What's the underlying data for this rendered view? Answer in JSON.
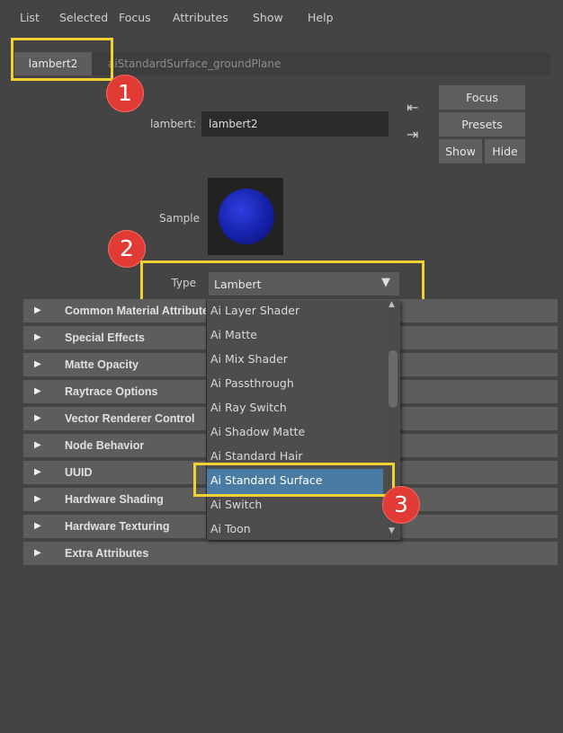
{
  "menu": [
    "List",
    "Selected",
    "Focus",
    "Attributes",
    "Show",
    "Help"
  ],
  "tabs": [
    {
      "label": "lambert2",
      "active": true
    },
    {
      "label": "aiStandardSurface_groundPlane",
      "active": false
    }
  ],
  "node": {
    "label": "lambert:",
    "value": "lambert2"
  },
  "buttons": {
    "focus": "Focus",
    "presets": "Presets",
    "show": "Show",
    "hide": "Hide"
  },
  "sample": {
    "label": "Sample"
  },
  "type": {
    "label": "Type",
    "selected": "Lambert"
  },
  "sections": [
    "Common Material Attributes",
    "Special Effects",
    "Matte Opacity",
    "Raytrace Options",
    "Vector Renderer Control",
    "Node Behavior",
    "UUID",
    "Hardware Shading",
    "Hardware Texturing",
    "Extra Attributes"
  ],
  "dropdown_options": [
    "Ai Layer Shader",
    "Ai Matte",
    "Ai Mix Shader",
    "Ai Passthrough",
    "Ai Ray Switch",
    "Ai Shadow Matte",
    "Ai Standard Hair",
    "Ai Standard Surface",
    "Ai Switch",
    "Ai Toon"
  ],
  "dropdown_selected": "Ai Standard Surface",
  "callouts": [
    "1",
    "2",
    "3"
  ],
  "colors": {
    "highlight": "#f2d232",
    "badge": "#e23b35",
    "selection": "#4a7ca3"
  }
}
